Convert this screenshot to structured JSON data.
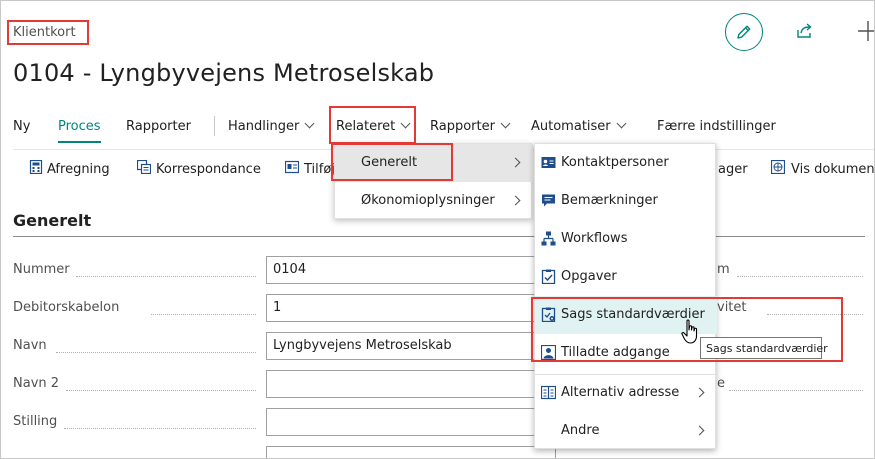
{
  "header": {
    "breadcrumb": "Klientkort",
    "title": "0104 - Lyngbyvejens Metroselskab"
  },
  "icons": {
    "edit": "pencil-icon",
    "share": "share-icon",
    "new": "plus-icon"
  },
  "actionbar": {
    "items": [
      {
        "label": "Ny"
      },
      {
        "label": "Proces"
      },
      {
        "label": "Rapporter"
      },
      {
        "label": "Handlinger"
      },
      {
        "label": "Relateret"
      },
      {
        "label": "Rapporter"
      },
      {
        "label": "Automatiser"
      },
      {
        "label": "Færre indstillinger"
      }
    ]
  },
  "toolbar": {
    "items": [
      {
        "label": "Afregning"
      },
      {
        "label": "Korrespondance"
      },
      {
        "label": "Tilføj"
      },
      {
        "label": "ager"
      },
      {
        "label": "Vis dokumen"
      }
    ]
  },
  "section": {
    "title": "Generelt"
  },
  "fields": [
    {
      "label": "Nummer",
      "value": "0104"
    },
    {
      "label": "Debitorskabelon",
      "value": "1"
    },
    {
      "label": "Navn",
      "value": "Lyngbyvejens Metroselskab"
    },
    {
      "label": "Navn 2",
      "value": ""
    },
    {
      "label": "Stilling",
      "value": ""
    }
  ],
  "right_fields": [
    {
      "label": "m"
    },
    {
      "label": "vitet"
    },
    {
      "label": "e"
    }
  ],
  "menu_related": {
    "items": [
      {
        "label": "Generelt"
      },
      {
        "label": "Økonomioplysninger"
      }
    ]
  },
  "menu_general": {
    "items": [
      {
        "label": "Kontaktpersoner",
        "icon": "contact-card-icon"
      },
      {
        "label": "Bemærkninger",
        "icon": "comments-icon"
      },
      {
        "label": "Workflows",
        "icon": "workflow-icon"
      },
      {
        "label": "Opgaver",
        "icon": "task-icon"
      },
      {
        "label": "Sags standardværdier",
        "icon": "case-defaults-icon"
      },
      {
        "label": "Tilladte adgange",
        "icon": "user-access-icon"
      },
      {
        "label": "Alternativ adresse",
        "icon": "address-book-icon"
      },
      {
        "label": "Andre",
        "icon": ""
      }
    ]
  },
  "tooltip": {
    "text": "Sags standardværdier"
  },
  "colors": {
    "accent": "#00857f",
    "highlight_box": "#e53935",
    "hover": "#e0f2f1"
  }
}
